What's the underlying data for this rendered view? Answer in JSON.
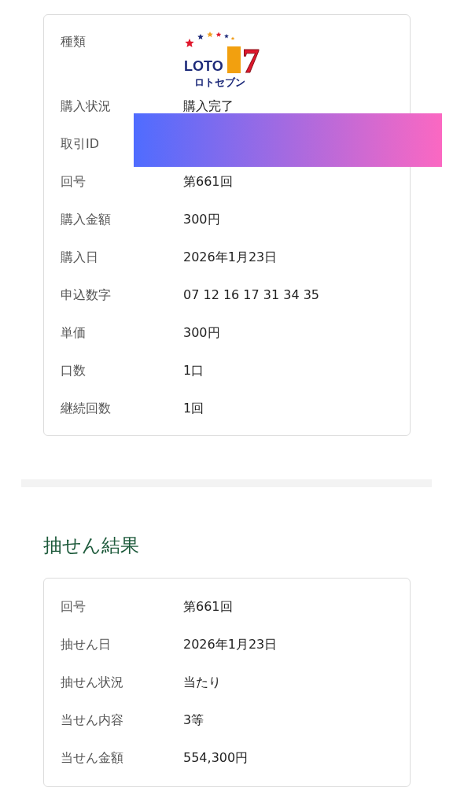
{
  "purchase_details": {
    "rows": [
      {
        "kind": "logo",
        "label": "種類",
        "logo": {
          "wordmark": "LOTO",
          "numeral": "7",
          "caption": "ロトセブン"
        }
      },
      {
        "kind": "text",
        "label": "購入状況",
        "value": "購入完了"
      },
      {
        "kind": "redacted",
        "label": "取引ID"
      },
      {
        "kind": "text",
        "label": "回号",
        "value": "第661回"
      },
      {
        "kind": "text",
        "label": "購入金額",
        "value": "300円"
      },
      {
        "kind": "text",
        "label": "購入日",
        "value": "2026年1月23日"
      },
      {
        "kind": "text",
        "label": "申込数字",
        "value": "07 12 16 17 31 34 35"
      },
      {
        "kind": "text",
        "label": "単価",
        "value": "300円"
      },
      {
        "kind": "text",
        "label": "口数",
        "value": "1口"
      },
      {
        "kind": "text",
        "label": "継続回数",
        "value": "1回"
      }
    ]
  },
  "section_heading": "抽せん結果",
  "draw_result": {
    "rows": [
      {
        "kind": "text",
        "label": "回号",
        "value": "第661回"
      },
      {
        "kind": "text",
        "label": "抽せん日",
        "value": "2026年1月23日"
      },
      {
        "kind": "text",
        "label": "抽せん状況",
        "value": "当たり"
      },
      {
        "kind": "text",
        "label": "当せん内容",
        "value": "3等"
      },
      {
        "kind": "text",
        "label": "当せん金額",
        "value": "554,300円"
      }
    ]
  }
}
